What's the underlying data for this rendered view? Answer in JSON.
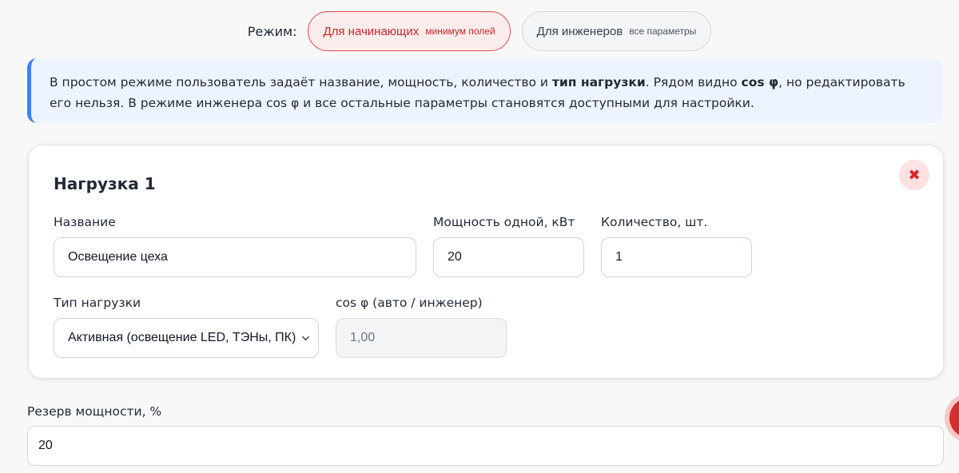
{
  "mode": {
    "label": "Режим:",
    "options": [
      {
        "title": "Для начинающих",
        "subtitle": "минимум полей",
        "active": true
      },
      {
        "title": "Для инженеров",
        "subtitle": "все параметры",
        "active": false
      }
    ]
  },
  "info": {
    "part1": "В простом режиме пользователь задаёт название, мощность, количество и ",
    "bold1": "тип нагрузки",
    "part2": ". Рядом видно ",
    "bold2": "cos φ",
    "part3": ", но редактировать его нельзя. В режиме инженера cos φ и все остальные параметры становятся доступными для настройки."
  },
  "load": {
    "title": "Нагрузка 1",
    "remove_icon": "✖",
    "name_label": "Название",
    "name_value": "Освещение цеха",
    "power_label": "Мощность одной, кВт",
    "power_value": "20",
    "qty_label": "Количество, шт.",
    "qty_value": "1",
    "type_label": "Тип нагрузки",
    "type_value": "Активная (освещение LED, ТЭНы, ПК)",
    "cos_label": "cos φ (авто / инженер)",
    "cos_value": "1,00"
  },
  "reserve": {
    "label": "Резерв мощности, %",
    "value": "20"
  },
  "colors": {
    "accent": "#3b82f6",
    "danger": "#dc2626"
  }
}
